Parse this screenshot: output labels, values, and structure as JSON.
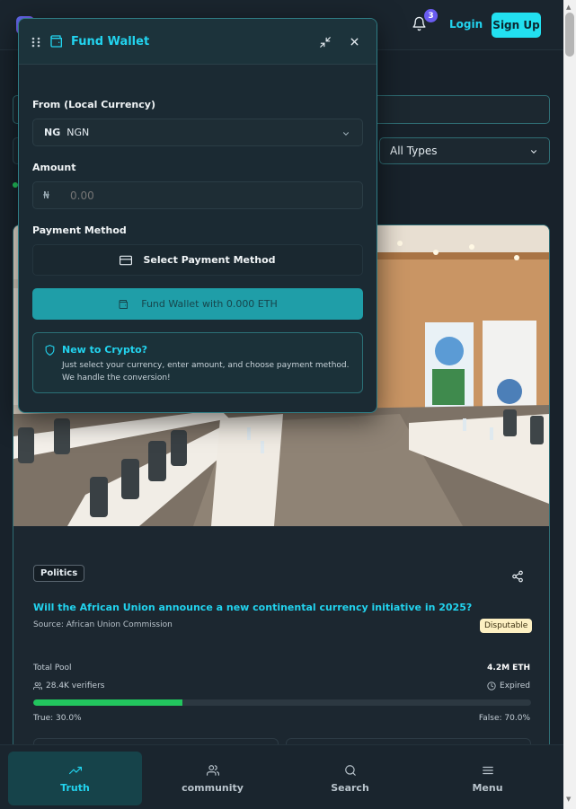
{
  "header": {
    "notification_count": "3",
    "login_label": "Login",
    "signup_label": "Sign Up"
  },
  "filters": {
    "type_selected": "All Types"
  },
  "card": {
    "category": "Politics",
    "question": "Will the African Union announce a new continental currency initiative in 2025?",
    "source": "Source: African Union Commission",
    "status": "Disputable",
    "pool_label": "Total Pool",
    "pool_value": "4.2M ETH",
    "verifiers": "28.4K verifiers",
    "expiry": "Expired",
    "true_label": "True: 30.0%",
    "false_label": "False: 70.0%",
    "true_fraction": 0.3
  },
  "nav": {
    "items": [
      {
        "label": "Truth",
        "icon": "trending-up-icon"
      },
      {
        "label": "community",
        "icon": "users-icon"
      },
      {
        "label": "Search",
        "icon": "search-icon"
      },
      {
        "label": "Menu",
        "icon": "menu-icon"
      }
    ]
  },
  "modal": {
    "title": "Fund Wallet",
    "from_label": "From (Local Currency)",
    "currency_flag": "NG",
    "currency_code": "NGN",
    "amount_label": "Amount",
    "currency_symbol": "₦",
    "amount_placeholder": "0.00",
    "payment_label": "Payment Method",
    "payment_select": "Select Payment Method",
    "fund_button": "Fund Wallet with 0.000 ETH",
    "info_title": "New to Crypto?",
    "info_text": "Just select your currency, enter amount, and choose payment method. We handle the conversion!"
  },
  "colors": {
    "accent": "#22d3ee",
    "true_bar": "#22c55e",
    "fund_button": "#1f9ea8",
    "disputable_bg": "#fdf0c2"
  }
}
